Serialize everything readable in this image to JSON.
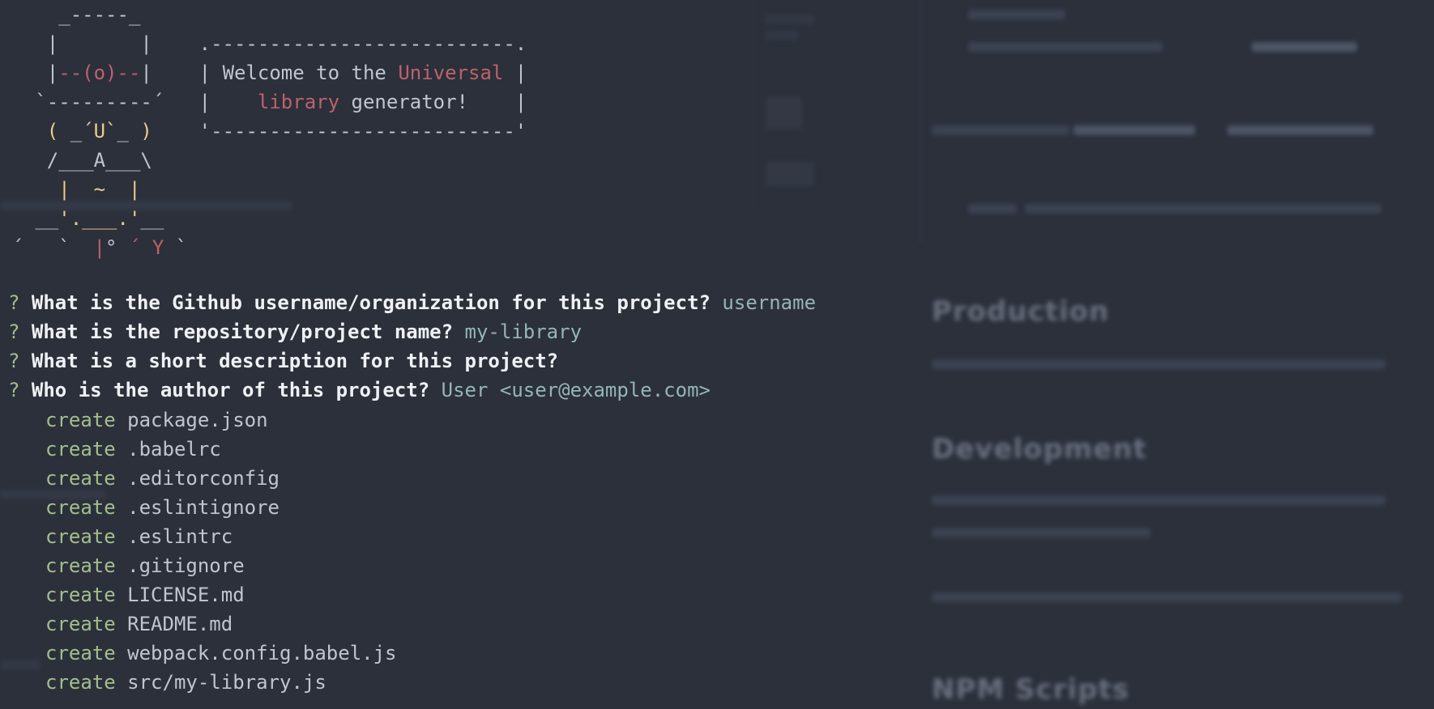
{
  "theme": {
    "background": "#2b303b",
    "text": "#c0c5ce",
    "accent_red": "#bf616a",
    "accent_yellow": "#ebcb8b",
    "accent_green": "#a3be8c",
    "accent_cyan": "#96b5b4"
  },
  "banner": {
    "welcome": "Welcome to the",
    "universal": "Universal",
    "library": "library",
    "generator": "generator!"
  },
  "background_doc": {
    "headings": [
      "Production",
      "Development",
      "NPM Scripts"
    ]
  },
  "prompts": [
    {
      "question": "What is the Github username/organization for this project?",
      "answer": "username"
    },
    {
      "question": "What is the repository/project name?",
      "answer": "my-library"
    },
    {
      "question": "What is a short description for this project?",
      "answer": ""
    },
    {
      "question": "Who is the author of this project?",
      "answer": "User <user@example.com>"
    }
  ],
  "create_verb": "create",
  "files": [
    "package.json",
    ".babelrc",
    ".editorconfig",
    ".eslintignore",
    ".eslintrc",
    ".gitignore",
    "LICENSE.md",
    "README.md",
    "webpack.config.babel.js",
    "src/my-library.js"
  ]
}
